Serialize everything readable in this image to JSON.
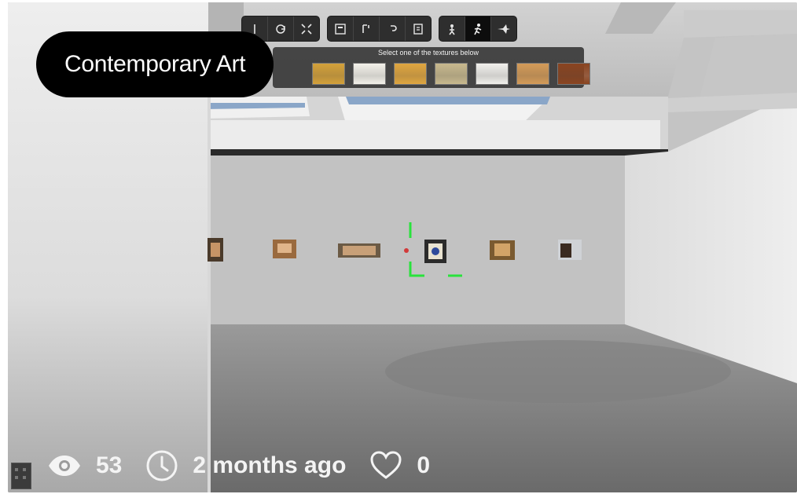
{
  "gallery": {
    "title": "Contemporary Art",
    "views": "53",
    "age": "2 months ago",
    "likes": "0"
  },
  "toolbar": {
    "groups": [
      [
        "move-icon",
        "rotate-icon",
        "scale-icon"
      ],
      [
        "frame-icon",
        "text-icon",
        "undo-icon",
        "document-icon"
      ],
      [
        "walk-icon",
        "run-icon",
        "fly-icon"
      ]
    ],
    "active_tool": "run-icon"
  },
  "texture_picker": {
    "caption": "Select one of the textures below",
    "swatches": [
      "#d4a13a",
      "#f3f1ea",
      "#e0a640",
      "#c8b98e",
      "#f1f0ec",
      "#d49b58",
      "#8a4420"
    ]
  },
  "colors": {
    "accent_selection": "#29e33c",
    "title_pill": "#000000"
  }
}
